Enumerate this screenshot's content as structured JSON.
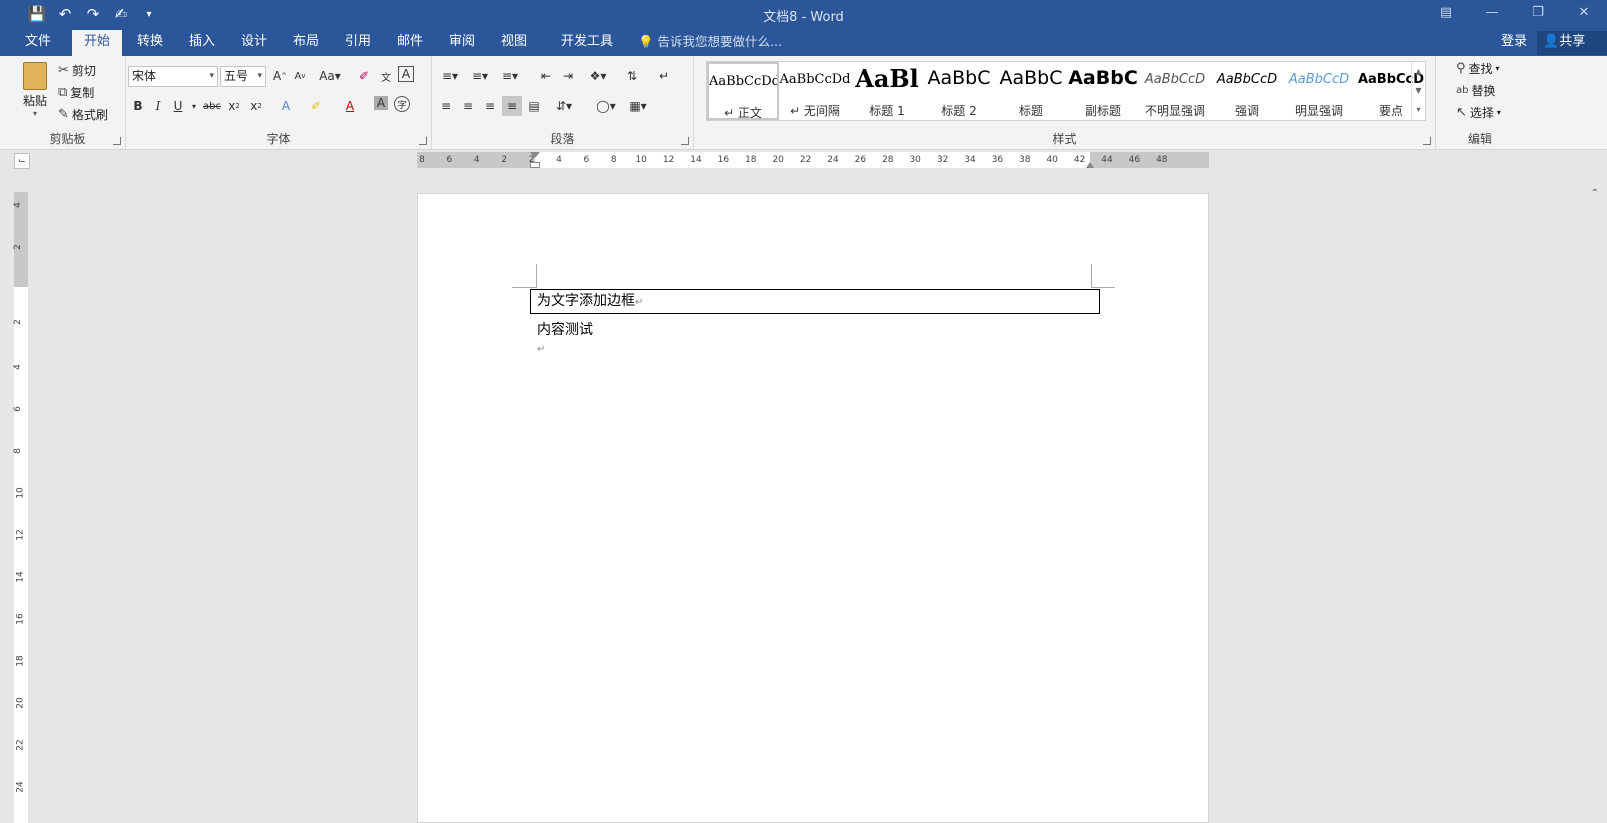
{
  "window": {
    "title": "文档8 - Word"
  },
  "qat": {
    "save_icon": "save-icon",
    "undo_icon": "undo-icon",
    "redo_icon": "redo-icon",
    "touch_icon": "touch-mode-icon",
    "customize_icon": "customize-qat-icon"
  },
  "tabs": [
    {
      "label": "文件"
    },
    {
      "label": "开始"
    },
    {
      "label": "转换"
    },
    {
      "label": "插入"
    },
    {
      "label": "设计"
    },
    {
      "label": "布局"
    },
    {
      "label": "引用"
    },
    {
      "label": "邮件"
    },
    {
      "label": "审阅"
    },
    {
      "label": "视图"
    },
    {
      "label": "开发工具"
    }
  ],
  "active_tab": "开始",
  "tell_me": "告诉我您想要做什么...",
  "account": {
    "login": "登录",
    "share": "共享"
  },
  "clipboard": {
    "paste": "粘贴",
    "cut": "剪切",
    "copy": "复制",
    "format_painter": "格式刷",
    "label": "剪贴板"
  },
  "font": {
    "name": "宋体",
    "size": "五号",
    "label": "字体"
  },
  "paragraph": {
    "label": "段落"
  },
  "styles": {
    "label": "样式",
    "items": [
      {
        "preview": "AaBbCcDd",
        "name": "↵ 正文"
      },
      {
        "preview": "AaBbCcDd",
        "name": "↵ 无间隔"
      },
      {
        "preview": "AaBl",
        "name": "标题 1"
      },
      {
        "preview": "AaBbC",
        "name": "标题 2"
      },
      {
        "preview": "AaBbC",
        "name": "标题"
      },
      {
        "preview": "AaBbC",
        "name": "副标题"
      },
      {
        "preview": "AaBbCcD",
        "name": "不明显强调"
      },
      {
        "preview": "AaBbCcD",
        "name": "强调"
      },
      {
        "preview": "AaBbCcD",
        "name": "明显强调"
      },
      {
        "preview": "AaBbCcD",
        "name": "要点"
      }
    ]
  },
  "editing": {
    "find": "查找",
    "replace": "替换",
    "select": "选择",
    "label": "编辑"
  },
  "ruler": {
    "h_ticks": [
      "8",
      "6",
      "4",
      "2",
      "2",
      "4",
      "6",
      "8",
      "10",
      "12",
      "14",
      "16",
      "18",
      "20",
      "22",
      "24",
      "26",
      "28",
      "30",
      "32",
      "34",
      "36",
      "38",
      "40",
      "42",
      "44",
      "46",
      "48"
    ],
    "v_ticks": [
      "4",
      "2",
      "2",
      "4",
      "6",
      "8",
      "10",
      "12",
      "14",
      "16",
      "18",
      "20",
      "22",
      "24"
    ]
  },
  "document": {
    "line1": "为文字添加边框",
    "line2": "内容测试",
    "para_mark": "↵"
  },
  "colors": {
    "accent": "#2b579a",
    "ribbon": "#f3f3f3",
    "workspace": "#e6e6e6"
  }
}
